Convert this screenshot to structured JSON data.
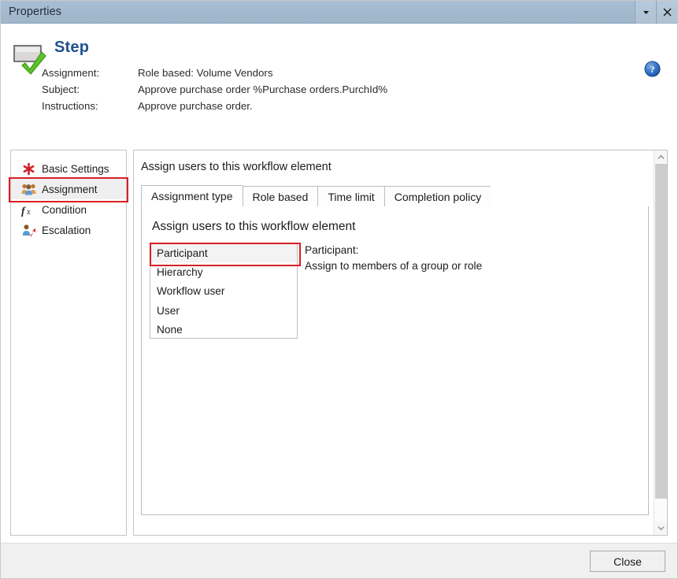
{
  "window": {
    "title": "Properties",
    "dropdown_icon": "chevron-down-icon",
    "close_icon": "close-icon"
  },
  "header": {
    "element_icon": "step-node-icon",
    "title": "Step",
    "help_icon": "help-question-icon",
    "fields": [
      {
        "label": "Assignment:",
        "value": "Role based: Volume Vendors"
      },
      {
        "label": "Subject:",
        "value": "Approve purchase order %Purchase orders.PurchId%"
      },
      {
        "label": "Instructions:",
        "value": "Approve purchase order."
      }
    ]
  },
  "sidebar": {
    "items": [
      {
        "label": "Basic Settings",
        "icon": "asterisk-icon",
        "selected": false
      },
      {
        "label": "Assignment",
        "icon": "users-group-icon",
        "selected": true
      },
      {
        "label": "Condition",
        "icon": "fx-function-icon",
        "selected": false
      },
      {
        "label": "Escalation",
        "icon": "user-arrow-icon",
        "selected": false
      }
    ]
  },
  "content": {
    "heading": "Assign users to this workflow element",
    "tabs": [
      {
        "label": "Assignment type",
        "active": true
      },
      {
        "label": "Role based",
        "active": false
      },
      {
        "label": "Time limit",
        "active": false
      },
      {
        "label": "Completion policy",
        "active": false
      }
    ],
    "panel": {
      "heading": "Assign users to this workflow element",
      "list_options": [
        {
          "label": "Participant",
          "selected": true
        },
        {
          "label": "Hierarchy",
          "selected": false
        },
        {
          "label": "Workflow user",
          "selected": false
        },
        {
          "label": "User",
          "selected": false
        },
        {
          "label": "None",
          "selected": false
        }
      ],
      "description_title": "Participant:",
      "description_text": "Assign to members of a group or role"
    },
    "scrollbar": {
      "up_icon": "chevron-up-icon",
      "down_icon": "chevron-down-icon"
    }
  },
  "footer": {
    "close_label": "Close"
  },
  "colors": {
    "titlebar": "#a3bace",
    "accent_title": "#20518c",
    "annotation_red": "#d81f26",
    "check_green": "#5cc22c"
  }
}
